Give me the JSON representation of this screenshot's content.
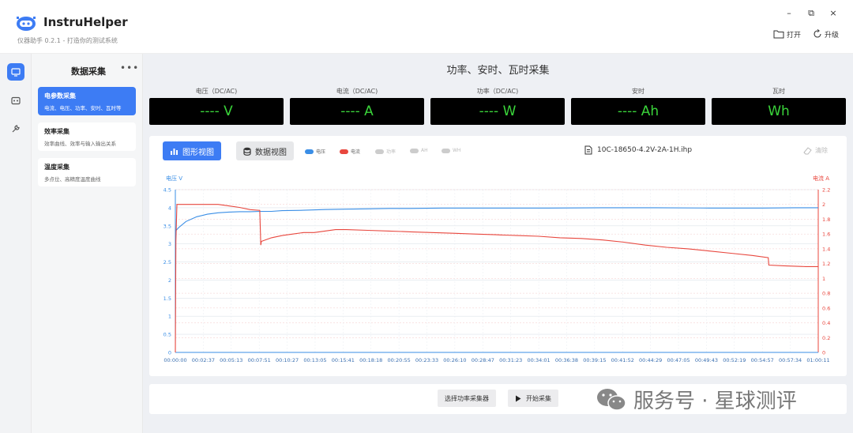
{
  "app": {
    "name": "InstruHelper",
    "subtitle": "仪器助手 0.2.1 - 打造你的测试系统",
    "accent": "#3d7cf4"
  },
  "window_controls": {
    "minimize": "–",
    "restore": "⧉",
    "close": "×"
  },
  "top_actions": {
    "open_label": "打开",
    "upgrade_label": "升级"
  },
  "rail": {
    "icons": [
      "monitor-icon",
      "device-icon",
      "wrench-icon"
    ],
    "active_index": 0
  },
  "sidebar": {
    "title": "数据采集",
    "more": "•••",
    "items": [
      {
        "title": "电参数采集",
        "desc": "电流、电压、功率、安时、瓦时等",
        "active": true
      },
      {
        "title": "效率采集",
        "desc": "效率曲线、效率与输入输出关系",
        "active": false
      },
      {
        "title": "温度采集",
        "desc": "多点位、高精度温度曲线",
        "active": false
      }
    ]
  },
  "main": {
    "title": "功率、安时、瓦时采集",
    "meters": [
      {
        "label": "电压（DC/AC)",
        "value": "---- V"
      },
      {
        "label": "电流（DC/AC)",
        "value": "---- A"
      },
      {
        "label": "功率（DC/AC)",
        "value": "---- W"
      },
      {
        "label": "安时",
        "value": "---- Ah"
      },
      {
        "label": "瓦时",
        "value": "Wh"
      }
    ],
    "toolbar": {
      "chart_view_label": "图形视图",
      "data_view_label": "数据视图",
      "legend": [
        {
          "label": "电压",
          "color": "#3a8ee6",
          "active": true
        },
        {
          "label": "电流",
          "color": "#e8473e",
          "active": true
        },
        {
          "label": "功率",
          "color": "#cccccc",
          "active": false
        },
        {
          "label": "AH",
          "color": "#cccccc",
          "active": false
        },
        {
          "label": "WH",
          "color": "#cccccc",
          "active": false
        }
      ],
      "file_name": "10C-18650-4.2V-2A-1H.ihp",
      "clear_label": "清除"
    },
    "bottom": {
      "select_label": "选择功率采集器",
      "start_label": "开始采集"
    }
  },
  "watermark": "服务号 · 星球测评",
  "chart_data": {
    "type": "line",
    "y1label": "电压 V",
    "y2label": "电流 A",
    "y1lim": [
      0,
      4.5
    ],
    "y2lim": [
      0,
      2.2
    ],
    "y1ticks": [
      "0",
      "0.5",
      "1",
      "1.5",
      "2",
      "2.5",
      "3",
      "3.5",
      "4",
      "4.5"
    ],
    "y2ticks": [
      "0",
      "0.2",
      "0.4",
      "0.6",
      "0.8",
      "1",
      "1.2",
      "1.4",
      "1.6",
      "1.8",
      "2",
      "2.2"
    ],
    "x_ticks": [
      "00:00:00",
      "00:02:37",
      "00:05:13",
      "00:07:51",
      "00:10:27",
      "00:13:05",
      "00:15:41",
      "00:18:18",
      "00:20:55",
      "00:23:33",
      "00:26:10",
      "00:28:47",
      "00:31:23",
      "00:34:01",
      "00:36:38",
      "00:39:15",
      "00:41:52",
      "00:44:29",
      "00:47:05",
      "00:49:43",
      "00:52:19",
      "00:54:57",
      "00:57:34",
      "01:00:11"
    ],
    "x_minutes_max": 60.18,
    "grid": true,
    "series": [
      {
        "name": "电压",
        "axis": "left",
        "color": "#3a8ee6",
        "x": [
          0,
          0.3,
          1,
          2,
          3,
          4,
          5,
          6,
          7,
          8,
          9,
          10,
          12,
          14,
          16,
          18,
          20,
          22,
          25,
          30,
          35,
          40,
          45,
          50,
          55,
          58,
          60.18
        ],
        "y": [
          3.35,
          3.45,
          3.62,
          3.75,
          3.82,
          3.86,
          3.88,
          3.89,
          3.89,
          3.9,
          3.9,
          3.92,
          3.93,
          3.95,
          3.96,
          3.97,
          3.98,
          3.98,
          3.99,
          3.99,
          3.99,
          4.0,
          4.0,
          3.99,
          3.99,
          4.0,
          4.0
        ]
      },
      {
        "name": "电流",
        "axis": "right",
        "color": "#e8473e",
        "x": [
          0,
          0.05,
          0.15,
          1,
          2,
          3,
          4,
          5,
          6,
          7,
          7.9,
          8.0,
          8.05,
          9,
          10,
          11,
          12,
          13,
          14,
          15,
          16,
          18,
          20,
          22,
          24,
          26,
          28,
          30,
          32,
          34,
          36,
          38,
          40,
          42,
          44,
          46,
          48,
          50,
          52,
          54,
          55.5,
          55.55,
          57,
          59,
          60.18
        ],
        "y": [
          0,
          1.5,
          2.0,
          2.0,
          2.0,
          2.0,
          2.0,
          1.98,
          1.96,
          1.93,
          1.92,
          1.45,
          1.5,
          1.55,
          1.58,
          1.6,
          1.62,
          1.62,
          1.64,
          1.66,
          1.66,
          1.65,
          1.64,
          1.63,
          1.62,
          1.61,
          1.6,
          1.59,
          1.58,
          1.57,
          1.55,
          1.54,
          1.52,
          1.49,
          1.45,
          1.42,
          1.4,
          1.37,
          1.34,
          1.31,
          1.28,
          1.18,
          1.17,
          1.16,
          1.16
        ]
      }
    ]
  }
}
